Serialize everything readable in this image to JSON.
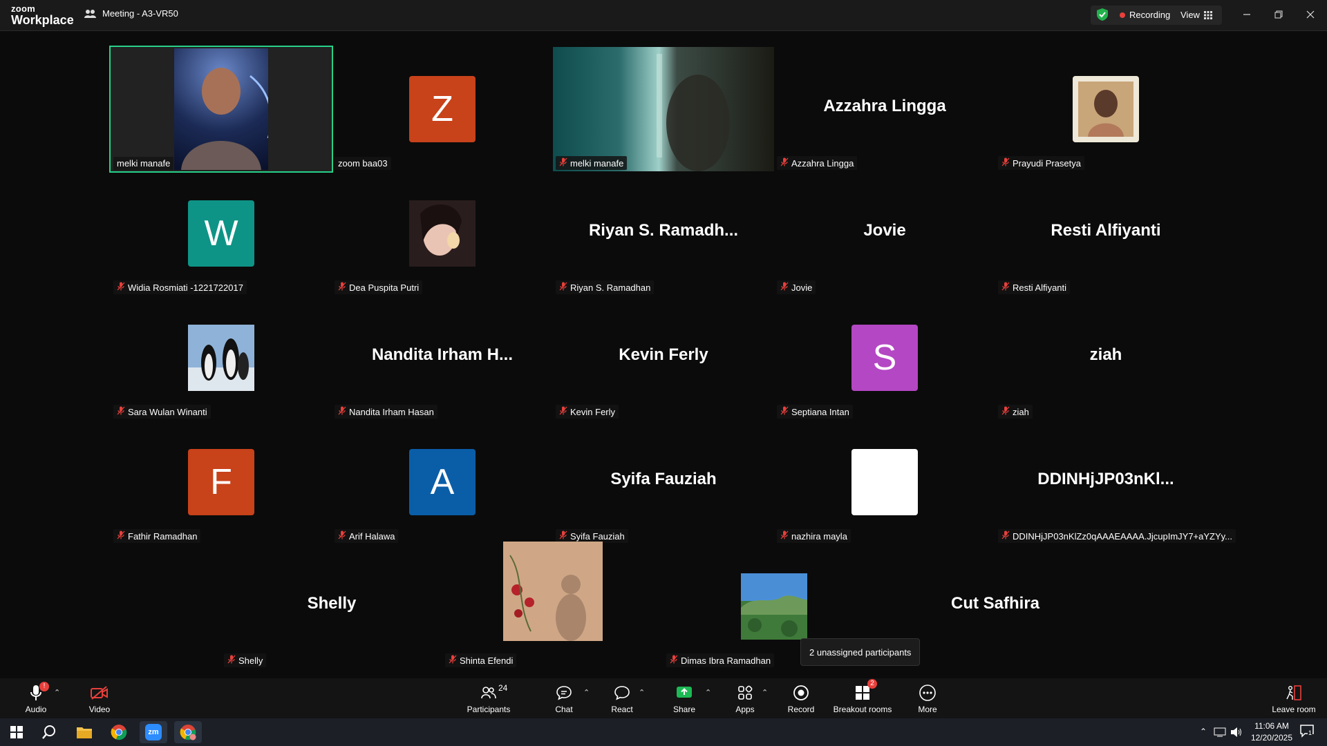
{
  "window": {
    "brand_small": "zoom",
    "brand_large": "Workplace",
    "meeting_title": "Meeting - A3-VR50",
    "recording_label": "Recording",
    "view_label": "View"
  },
  "colors": {
    "active_border": "#27d28a",
    "recording_dot": "#e8403c",
    "share_green": "#1db954"
  },
  "tiles": [
    {
      "label": "melki manafe",
      "center": "",
      "avatar_letter": "",
      "avatar_color": "",
      "type": "video-person",
      "muted": false
    },
    {
      "label": "zoom baa03",
      "center": "",
      "avatar_letter": "Z",
      "avatar_color": "#c8421a",
      "type": "letter",
      "muted": false
    },
    {
      "label": "melki manafe",
      "center": "",
      "avatar_letter": "",
      "avatar_color": "",
      "type": "video-window",
      "muted": true
    },
    {
      "label": "Azzahra Lingga",
      "center": "Azzahra Lingga",
      "type": "name",
      "muted": true
    },
    {
      "label": "Prayudi Prasetya",
      "center": "",
      "type": "photo-portrait",
      "muted": true
    },
    {
      "label": "Widia Rosmiati -1221722017",
      "center": "",
      "avatar_letter": "W",
      "avatar_color": "#0e9486",
      "type": "letter",
      "muted": true
    },
    {
      "label": "Dea Puspita Putri",
      "center": "",
      "type": "photo-girl",
      "muted": true
    },
    {
      "label": "Riyan S. Ramadhan",
      "center": "Riyan S. Ramadh...",
      "type": "name",
      "muted": true
    },
    {
      "label": "Jovie",
      "center": "Jovie",
      "type": "name",
      "muted": true
    },
    {
      "label": "Resti Alfiyanti",
      "center": "Resti Alfiyanti",
      "type": "name",
      "muted": true
    },
    {
      "label": "Sara Wulan Winanti",
      "center": "",
      "type": "photo-penguins",
      "muted": true
    },
    {
      "label": "Nandita Irham Hasan",
      "center": "Nandita Irham H...",
      "type": "name",
      "muted": true
    },
    {
      "label": "Kevin Ferly",
      "center": "Kevin Ferly",
      "type": "name",
      "muted": true
    },
    {
      "label": "Septiana Intan",
      "center": "",
      "avatar_letter": "S",
      "avatar_color": "#b447c4",
      "type": "letter",
      "muted": true
    },
    {
      "label": "ziah",
      "center": "ziah",
      "type": "name",
      "muted": true
    },
    {
      "label": "Fathir Ramadhan",
      "center": "",
      "avatar_letter": "F",
      "avatar_color": "#c8421a",
      "type": "letter",
      "muted": true
    },
    {
      "label": "Arif Halawa",
      "center": "",
      "avatar_letter": "A",
      "avatar_color": "#0a5ea8",
      "type": "letter",
      "muted": true
    },
    {
      "label": "Syifa Fauziah",
      "center": "Syifa Fauziah",
      "type": "name",
      "muted": true
    },
    {
      "label": "nazhira mayla",
      "center": "",
      "avatar_letter": "",
      "avatar_color": "#ffffff",
      "type": "letter",
      "muted": true
    },
    {
      "label": "DDINHjJP03nKlZz0qAAAEAAAA.JjcupImJY7+aYZYy...",
      "center": "DDINHjJP03nKl...",
      "type": "name",
      "muted": true
    },
    {
      "label": "Shelly",
      "center": "Shelly",
      "type": "name",
      "muted": true
    },
    {
      "label": "Shinta Efendi",
      "center": "",
      "type": "photo-roses",
      "muted": true
    },
    {
      "label": "Dimas Ibra Ramadhan",
      "center": "",
      "type": "photo-landscape",
      "muted": true
    },
    {
      "label": "hira",
      "center": "Cut Safhira",
      "type": "name",
      "muted": false
    }
  ],
  "tooltip": "2 unassigned participants",
  "toolbar": {
    "audio": "Audio",
    "video": "Video",
    "participants": "Participants",
    "participants_count": "24",
    "chat": "Chat",
    "react": "React",
    "share": "Share",
    "apps": "Apps",
    "record": "Record",
    "breakout": "Breakout rooms",
    "breakout_badge": "2",
    "more": "More",
    "leave": "Leave room",
    "audio_badge": "!"
  },
  "taskbar": {
    "time": "11:06 AM",
    "date": "12/20/2025",
    "notifications": "1",
    "icons": [
      "windows-start-icon",
      "search-icon",
      "file-explorer-icon",
      "chrome-icon",
      "zoom-icon",
      "chrome-profile-icon"
    ]
  }
}
